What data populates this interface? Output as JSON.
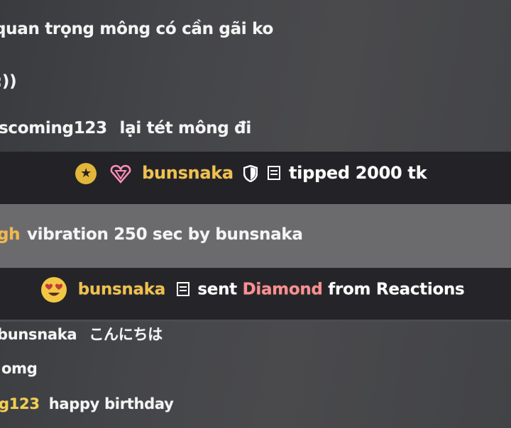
{
  "chat": {
    "line1": "quan trọng mông có cần gãi ko",
    "line2": ":))",
    "line3_user": "scoming123",
    "line3_text": "lại tét mông đi",
    "tip_event": {
      "username": "bunsnaka",
      "action": "tipped 2000 tk"
    },
    "vibration_prefix": "gh",
    "vibration_text": "vibration 250 sec by bunsnaka",
    "reaction_event": {
      "username": "bunsnaka",
      "sent": "sent",
      "item": "Diamond",
      "rest": "from Reactions"
    },
    "line7_user": "bunsnaka",
    "line7_text": "こんにちは",
    "line8": "omg",
    "line9_user": "g123",
    "line9_text": "happy birthday"
  },
  "colors": {
    "username_gold": "#f1c04d",
    "diamond": "#ff8f8f",
    "band_dark": "#232327",
    "band_light": "#6b6b6e"
  },
  "icons": [
    "star-badge-icon",
    "diamond-heart-icon",
    "shield-icon",
    "notes-icon",
    "heart-eyes-emoji-icon"
  ]
}
